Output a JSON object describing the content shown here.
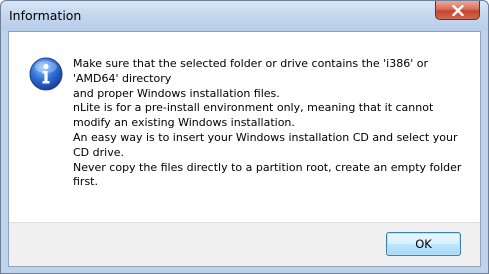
{
  "window": {
    "title": "Information",
    "close_icon": "close-icon"
  },
  "message": {
    "icon": "info-icon",
    "lines": [
      "Make sure that the selected folder or drive contains the 'i386' or",
      "'AMD64' directory",
      "and proper Windows installation files.",
      "nLite is for a pre-install environment only, meaning that it cannot",
      "modify an existing Windows installation.",
      "An easy way is to insert your Windows installation CD and select your",
      "CD drive.",
      "Never copy the files directly to a partition root, create an empty folder",
      "first."
    ]
  },
  "buttons": {
    "ok_label": "OK"
  },
  "colors": {
    "frame": "#bfd3ea",
    "close_button": "#c4442c",
    "info_icon": "#2a63c6",
    "ok_border": "#3c7fb1"
  }
}
